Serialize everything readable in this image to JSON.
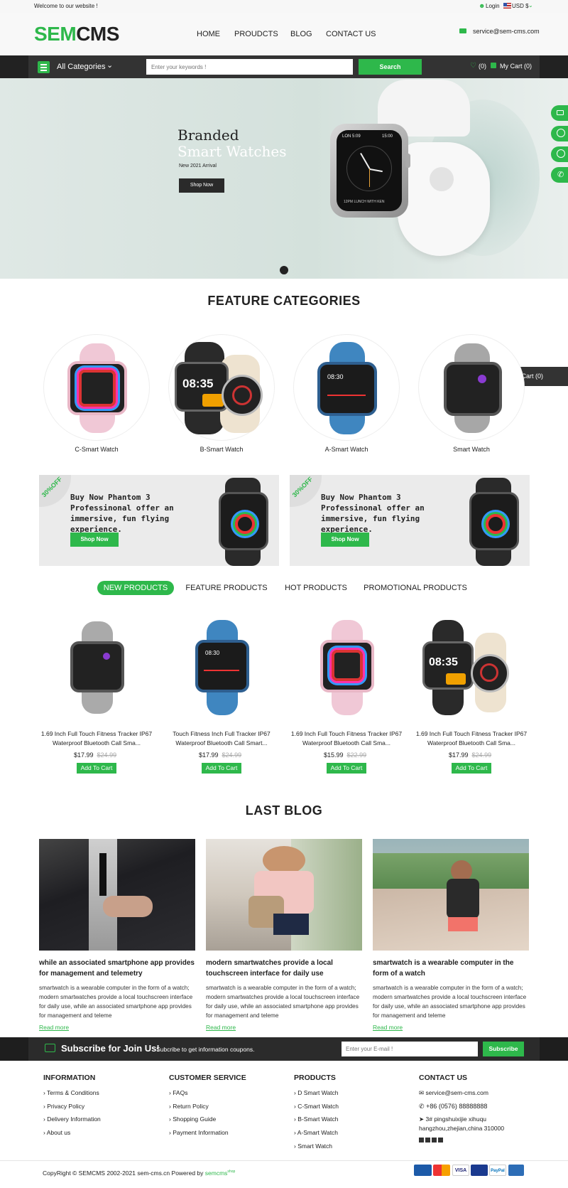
{
  "topbar": {
    "welcome": "Welcome to our website !",
    "login": "Login",
    "currency": "USD $"
  },
  "header": {
    "logo_sem": "SEM",
    "logo_cms": "CMS",
    "nav": [
      "HOME",
      "PROUDCTS",
      "BLOG",
      "CONTACT US"
    ],
    "email": "service@sem-cms.com"
  },
  "navbar": {
    "categories_label": "All Categories",
    "search_placeholder": "Enter your keywords !",
    "search_button": "Search",
    "wishlist_count": "(0)",
    "cart_label": "My Cart (0)"
  },
  "hero": {
    "line1": "Branded",
    "line2": "Smart Watches",
    "line3": "New 2021 Arrival",
    "button": "Shop Now",
    "watch_top_left": "LON 5:09",
    "watch_top_right": "15:00",
    "watch_bottom": "12PM LUNCH WITH KEN"
  },
  "floating_cart": "My Cart (0)",
  "feature_categories": {
    "title": "FEATURE CATEGORIES",
    "items": [
      "C-Smart Watch",
      "B-Smart Watch",
      "A-Smart Watch",
      "Smart Watch"
    ]
  },
  "promos": [
    {
      "badge": "30%OFF",
      "text": "Buy Now Phantom 3 Professinonal offer an immersive, fun flying experience.",
      "button": "Shop Now"
    },
    {
      "badge": "30%OFF",
      "text": "Buy Now Phantom 3 Professinonal offer an immersive, fun flying experience.",
      "button": "Shop Now"
    }
  ],
  "product_tabs": [
    "NEW PRODUCTS",
    "FEATURE PRODUCTS",
    "HOT PRODUCTS",
    "PROMOTIONAL PRODUCTS"
  ],
  "products": [
    {
      "title": "1.69 Inch Full Touch Fitness Tracker IP67 Waterproof Bluetooth Call Sma...",
      "price": "$17.99",
      "old_price": "$24.99",
      "button": "Add To Cart"
    },
    {
      "title": "Touch Fitness Inch Full Tracker IP67 Waterproof Bluetooth Call Smart...",
      "price": "$17.99",
      "old_price": "$24.99",
      "button": "Add To Cart"
    },
    {
      "title": "1.69 Inch Full Touch Fitness Tracker IP67 Waterproof Bluetooth Call Sma...",
      "price": "$15.99",
      "old_price": "$22.99",
      "button": "Add To Cart"
    },
    {
      "title": "1.69 Inch Full Touch Fitness Tracker IP67 Waterproof Bluetooth Call Sma...",
      "price": "$17.99",
      "old_price": "$24.99",
      "button": "Add To Cart"
    }
  ],
  "blog": {
    "title": "LAST BLOG",
    "posts": [
      {
        "title": "while an associated smartphone app provides for management and telemetry",
        "text": "smartwatch is a wearable computer in the form of a watch; modern smartwatches provide a local touchscreen interface for daily use, while an associated smartphone app provides for management and teleme",
        "link": "Read more"
      },
      {
        "title": "modern smartwatches provide a local touchscreen interface for daily use",
        "text": "smartwatch is a wearable computer in the form of a watch; modern smartwatches provide a local touchscreen interface for daily use, while an associated smartphone app provides for management and teleme",
        "link": "Read more"
      },
      {
        "title": "smartwatch is a wearable computer in the form of a watch",
        "text": "smartwatch is a wearable computer in the form of a watch; modern smartwatches provide a local touchscreen interface for daily use, while an associated smartphone app provides for management and teleme",
        "link": "Read more"
      }
    ]
  },
  "subscribe": {
    "title": "Subscribe for Join Us!",
    "subtitle": "Subcribe to get information coupons.",
    "placeholder": "Enter your E-mail !",
    "button": "Subscribe"
  },
  "footer": {
    "information": {
      "title": "INFORMATION",
      "links": [
        "Terms & Conditions",
        "Privacy Policy",
        "Delivery Information",
        "About us"
      ]
    },
    "customer_service": {
      "title": "CUSTOMER SERVICE",
      "links": [
        "FAQs",
        "Return Policy",
        "Shopping Guide",
        "Payment Information"
      ]
    },
    "products": {
      "title": "PRODUCTS",
      "links": [
        "D Smart Watch",
        "C-Smart Watch",
        "B-Smart Watch",
        "A-Smart Watch",
        "Smart Watch"
      ]
    },
    "contact": {
      "title": "CONTACT US",
      "email": "service@sem-cms.com",
      "phone": "+86  (0576)  88888888",
      "address_line1": "3# pingshuixijie xihuqu",
      "address_line2": "hangzhou,zhejian,china 310000"
    }
  },
  "copyright": {
    "text": "CopyRight © SEMCMS 2002-2021 sem-cms.cn Powered by ",
    "brand": "semcms",
    "brand_sup": "shop"
  },
  "payments": [
    "",
    "",
    "VISA",
    "",
    "PayPal",
    ""
  ],
  "colors": {
    "accent": "#2eb84b",
    "dark": "#2b2b2b"
  }
}
